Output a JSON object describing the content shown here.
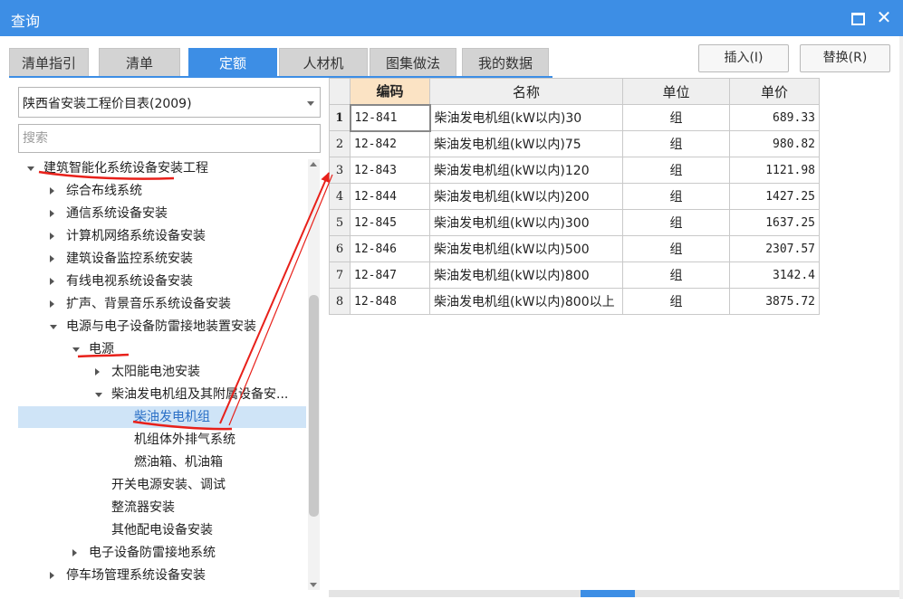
{
  "window": {
    "title": "查询"
  },
  "tabs": [
    {
      "label": "清单指引",
      "active": false
    },
    {
      "label": "清单",
      "active": false
    },
    {
      "label": "定额",
      "active": true
    },
    {
      "label": "人材机",
      "active": false
    },
    {
      "label": "图集做法",
      "active": false
    },
    {
      "label": "我的数据",
      "active": false
    }
  ],
  "actions": {
    "insert_label": "插入(I)",
    "replace_label": "替换(R)"
  },
  "library": {
    "selected": "陕西省安装工程价目表(2009)"
  },
  "search": {
    "placeholder": "搜索"
  },
  "tree": [
    {
      "label": "建筑智能化系统设备安装工程",
      "expander": "expanded"
    },
    {
      "label": "综合布线系统",
      "expander": "collapsed"
    },
    {
      "label": "通信系统设备安装",
      "expander": "collapsed"
    },
    {
      "label": "计算机网络系统设备安装",
      "expander": "collapsed"
    },
    {
      "label": "建筑设备监控系统安装",
      "expander": "collapsed"
    },
    {
      "label": "有线电视系统设备安装",
      "expander": "collapsed"
    },
    {
      "label": "扩声、背景音乐系统设备安装",
      "expander": "collapsed"
    },
    {
      "label": "电源与电子设备防雷接地装置安装",
      "expander": "expanded"
    },
    {
      "label": "电源",
      "expander": "expanded"
    },
    {
      "label": "太阳能电池安装",
      "expander": "collapsed"
    },
    {
      "label": "柴油发电机组及其附属设备安...",
      "expander": "expanded"
    },
    {
      "label": "柴油发电机组",
      "expander": "none",
      "selected": true
    },
    {
      "label": "机组体外排气系统",
      "expander": "none"
    },
    {
      "label": "燃油箱、机油箱",
      "expander": "none"
    },
    {
      "label": "开关电源安装、调试",
      "expander": "none"
    },
    {
      "label": "整流器安装",
      "expander": "none"
    },
    {
      "label": "其他配电设备安装",
      "expander": "none"
    },
    {
      "label": "电子设备防雷接地系统",
      "expander": "collapsed"
    },
    {
      "label": "停车场管理系统设备安装",
      "expander": "collapsed"
    }
  ],
  "table": {
    "headers": {
      "code": "编码",
      "name": "名称",
      "unit": "单位",
      "price": "单价"
    },
    "rows": [
      {
        "no": "1",
        "code": "12-841",
        "name": "柴油发电机组(kW以内)30",
        "unit": "组",
        "price": "689.33"
      },
      {
        "no": "2",
        "code": "12-842",
        "name": "柴油发电机组(kW以内)75",
        "unit": "组",
        "price": "980.82"
      },
      {
        "no": "3",
        "code": "12-843",
        "name": "柴油发电机组(kW以内)120",
        "unit": "组",
        "price": "1121.98"
      },
      {
        "no": "4",
        "code": "12-844",
        "name": "柴油发电机组(kW以内)200",
        "unit": "组",
        "price": "1427.25"
      },
      {
        "no": "5",
        "code": "12-845",
        "name": "柴油发电机组(kW以内)300",
        "unit": "组",
        "price": "1637.25"
      },
      {
        "no": "6",
        "code": "12-846",
        "name": "柴油发电机组(kW以内)500",
        "unit": "组",
        "price": "2307.57"
      },
      {
        "no": "7",
        "code": "12-847",
        "name": "柴油发电机组(kW以内)800",
        "unit": "组",
        "price": "3142.4"
      },
      {
        "no": "8",
        "code": "12-848",
        "name": "柴油发电机组(kW以内)800以上",
        "unit": "组",
        "price": "3875.72"
      }
    ]
  },
  "colors": {
    "accent": "#3d8ee5",
    "annotation": "#e8201a",
    "selected_row": "#cfe4f7",
    "code_header": "#fbe3c4"
  }
}
